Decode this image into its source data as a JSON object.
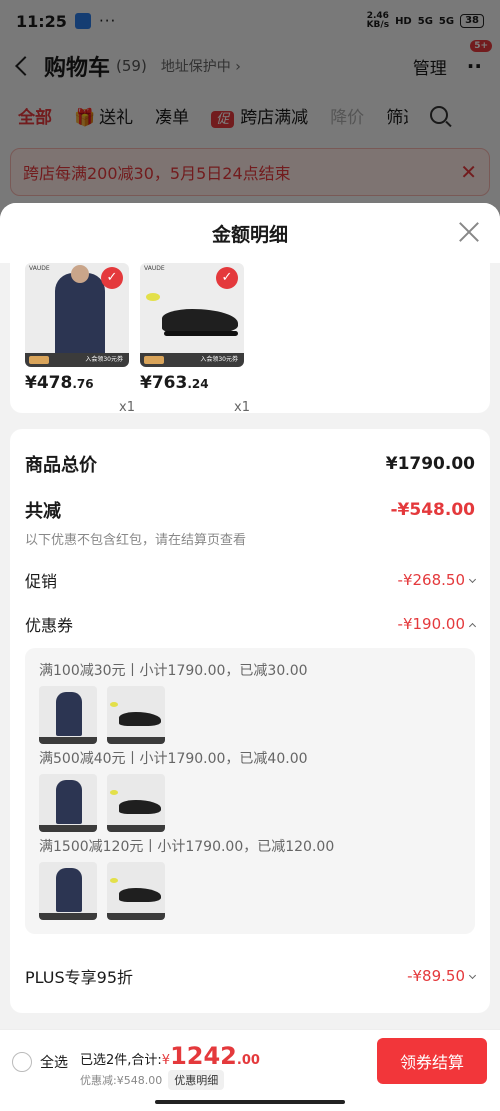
{
  "status_bar": {
    "time": "11:25",
    "dots": "···",
    "net_speed_value": "2.46",
    "net_speed_unit": "KB/s",
    "hd": "HD",
    "signal1": "5G",
    "signal2": "5G",
    "battery": "38"
  },
  "nav": {
    "title": "购物车",
    "count": "(59)",
    "address": "地址保护中 ›",
    "manage": "管理",
    "badge": "5+"
  },
  "tabs": [
    {
      "label": "全部"
    },
    {
      "label": "送礼"
    },
    {
      "label": "凑单"
    },
    {
      "label": "跨店满减",
      "tag": "促"
    },
    {
      "label": "降价"
    },
    {
      "label": "筛选"
    }
  ],
  "banner": {
    "text": "跨店每满200减30，5月5日24点结束"
  },
  "sheet": {
    "title": "金额明细",
    "products": [
      {
        "price_int": "¥478",
        "price_dec": ".76",
        "qty": "x1",
        "brand": "VAUDE",
        "strip": "入会领30元券"
      },
      {
        "price_int": "¥763",
        "price_dec": ".24",
        "qty": "x1",
        "brand": "VAUDE",
        "strip": "入会领30元券"
      }
    ],
    "total_label": "商品总价",
    "total_value": "¥1790.00",
    "reduce_label": "共减",
    "reduce_value": "-¥548.00",
    "note": "以下优惠不包含红包，请在结算页查看",
    "promo_label": "促销",
    "promo_value": "-¥268.50",
    "coupon_label": "优惠券",
    "coupon_value": "-¥190.00",
    "tiers": [
      {
        "label": "满100减30元丨小计1790.00，已减30.00"
      },
      {
        "label": "满500减40元丨小计1790.00，已减40.00"
      },
      {
        "label": "满1500减120元丨小计1790.00，已减120.00"
      }
    ],
    "plus_label": "PLUS专享95折",
    "plus_value": "-¥89.50"
  },
  "bottom": {
    "select_all": "全选",
    "selected": "已选2件,合计:",
    "currency": "¥",
    "total_int": "1242",
    "total_dec": ".00",
    "discount": "优惠减:¥548.00",
    "detail_chip": "优惠明细",
    "checkout": "领券结算"
  },
  "colors": {
    "accent": "#e4393c",
    "checkout": "#f2363a"
  }
}
